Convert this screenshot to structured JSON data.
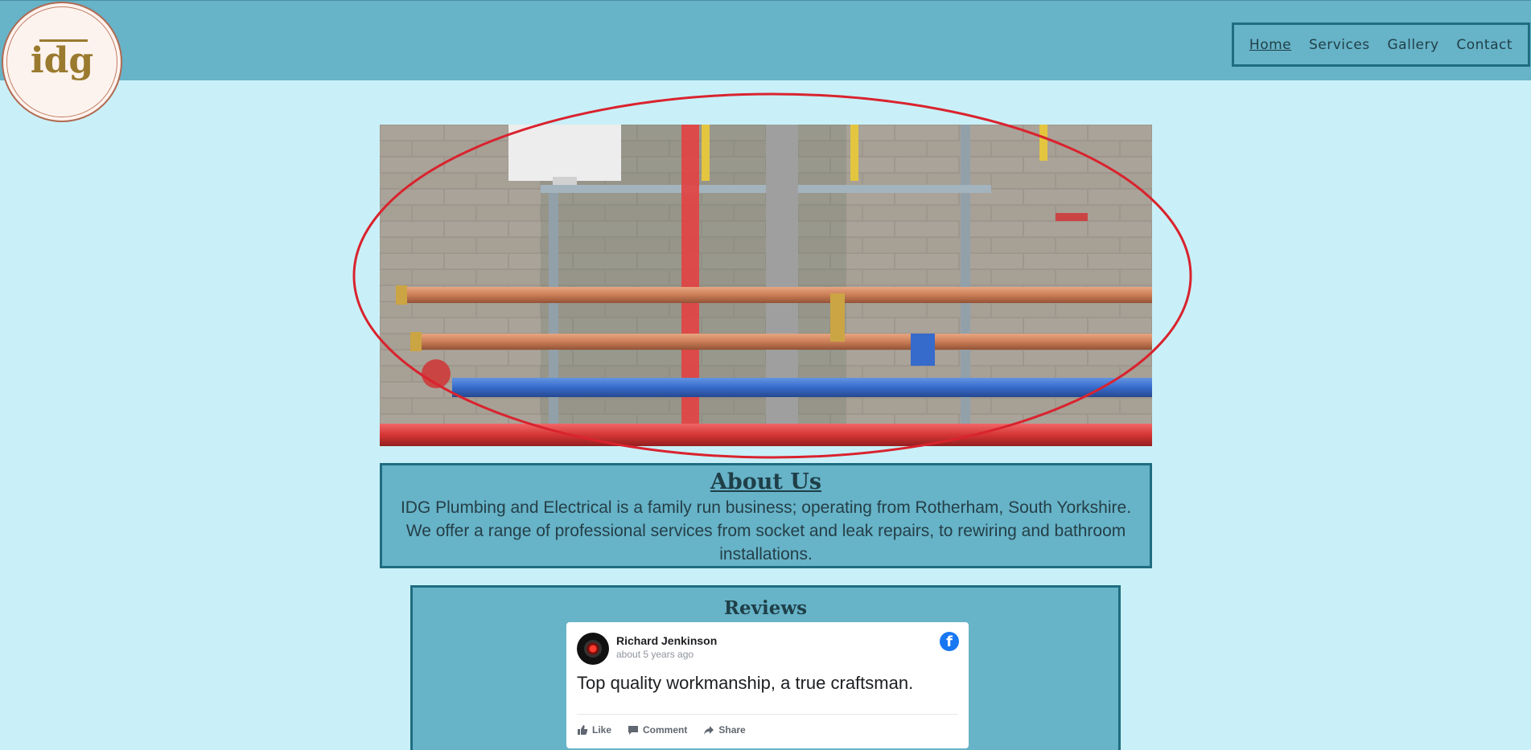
{
  "header": {
    "logo_text": "idg",
    "nav": [
      {
        "label": "Home",
        "active": true
      },
      {
        "label": "Services",
        "active": false
      },
      {
        "label": "Gallery",
        "active": false
      },
      {
        "label": "Contact",
        "active": false
      }
    ]
  },
  "hero": {
    "icon": "plumbing-pipes-photo",
    "annotation_color": "#d9232e"
  },
  "about": {
    "title": "About Us",
    "text": "IDG Plumbing and Electrical is a family run business; operating from Rotherham, South Yorkshire. We offer a range of professional services from socket and leak repairs, to rewiring and bathroom installations."
  },
  "reviews": {
    "title": "Reviews",
    "card": {
      "reviewer": "Richard Jenkinson",
      "time": "about 5 years ago",
      "text": "Top quality workmanship, a true craftsman.",
      "actions": {
        "like": "Like",
        "comment": "Comment",
        "share": "Share"
      }
    }
  },
  "colors": {
    "page_bg": "#c9f0f8",
    "header_bg": "#67b3c8",
    "border": "#1e6d80",
    "logo_gold": "#9a7a2e",
    "facebook_blue": "#1877f2"
  }
}
